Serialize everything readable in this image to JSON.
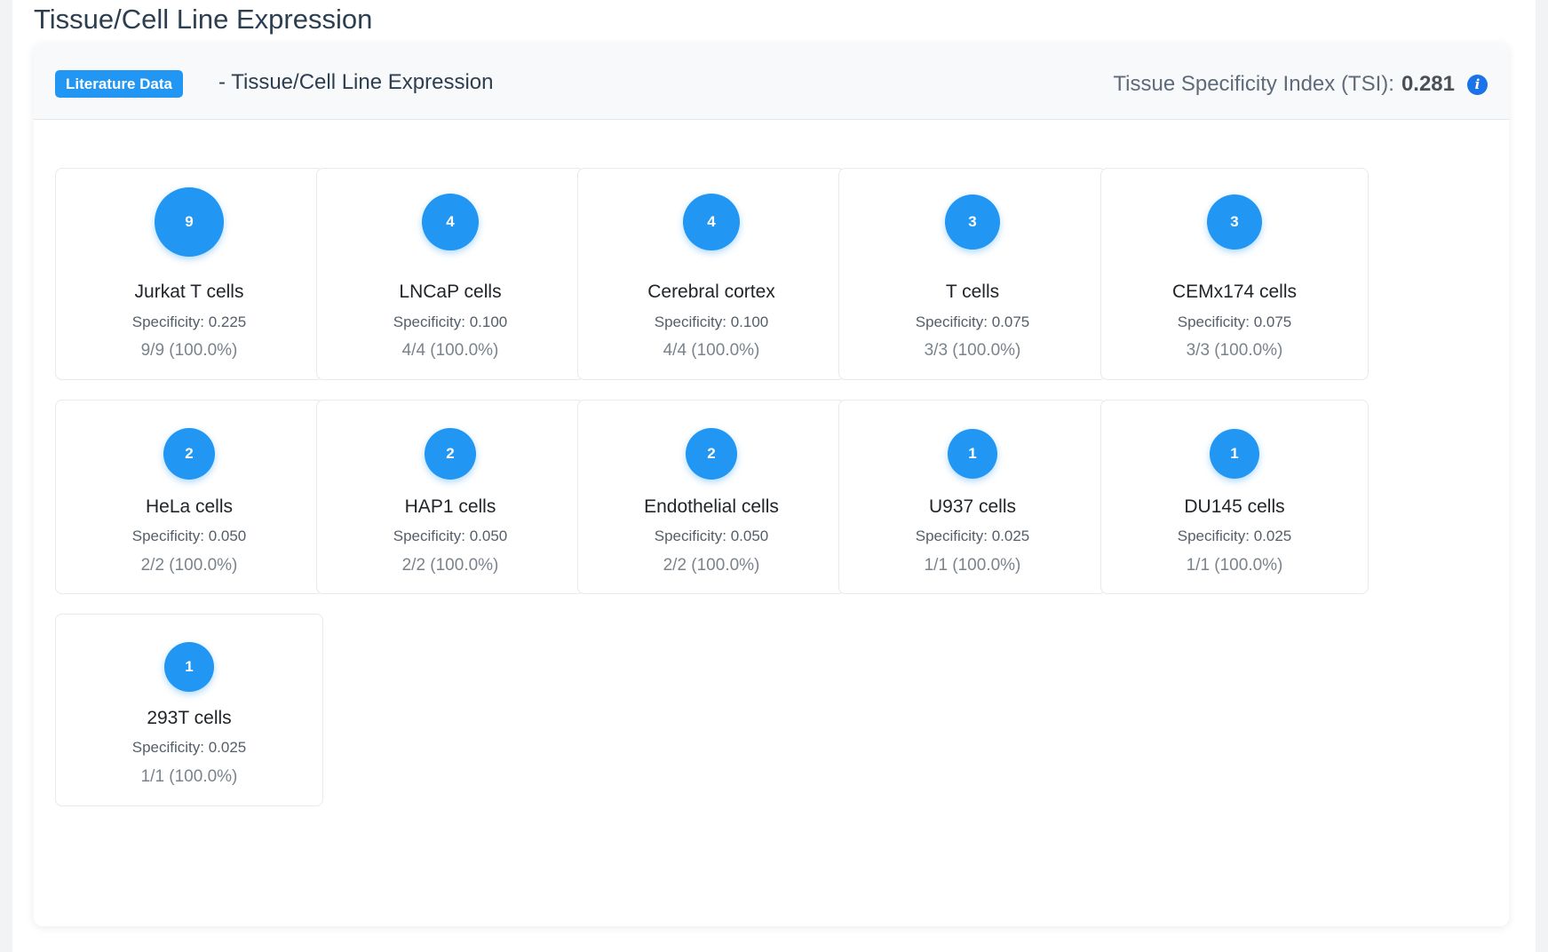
{
  "page_title": "Tissue/Cell Line Expression",
  "header": {
    "badge": "Literature Data",
    "title": "- Tissue/Cell Line Expression",
    "tsi_label": "Tissue Specificity Index (TSI):",
    "tsi_value": "0.281",
    "info_icon": "info-icon"
  },
  "colors": {
    "accent": "#2196f3",
    "info": "#1a73e8"
  },
  "tiles": [
    {
      "count": "9",
      "name": "Jurkat T cells",
      "specificity": "Specificity: 0.225",
      "ratio": "9/9 (100.0%)"
    },
    {
      "count": "4",
      "name": "LNCaP cells",
      "specificity": "Specificity: 0.100",
      "ratio": "4/4 (100.0%)"
    },
    {
      "count": "4",
      "name": "Cerebral cortex",
      "specificity": "Specificity: 0.100",
      "ratio": "4/4 (100.0%)"
    },
    {
      "count": "3",
      "name": "T cells",
      "specificity": "Specificity: 0.075",
      "ratio": "3/3 (100.0%)"
    },
    {
      "count": "3",
      "name": "CEMx174 cells",
      "specificity": "Specificity: 0.075",
      "ratio": "3/3 (100.0%)"
    },
    {
      "count": "2",
      "name": "HeLa cells",
      "specificity": "Specificity: 0.050",
      "ratio": "2/2 (100.0%)"
    },
    {
      "count": "2",
      "name": "HAP1 cells",
      "specificity": "Specificity: 0.050",
      "ratio": "2/2 (100.0%)"
    },
    {
      "count": "2",
      "name": "Endothelial cells",
      "specificity": "Specificity: 0.050",
      "ratio": "2/2 (100.0%)"
    },
    {
      "count": "1",
      "name": "U937 cells",
      "specificity": "Specificity: 0.025",
      "ratio": "1/1 (100.0%)"
    },
    {
      "count": "1",
      "name": "DU145 cells",
      "specificity": "Specificity: 0.025",
      "ratio": "1/1 (100.0%)"
    },
    {
      "count": "1",
      "name": "293T cells",
      "specificity": "Specificity: 0.025",
      "ratio": "1/1 (100.0%)"
    }
  ]
}
